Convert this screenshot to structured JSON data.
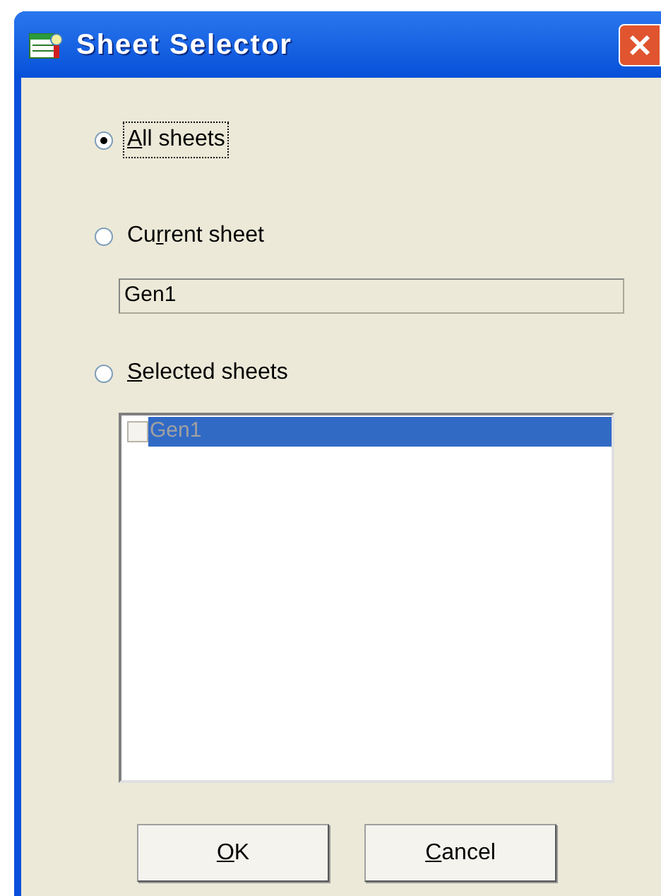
{
  "window": {
    "title": "Sheet Selector"
  },
  "options": [
    {
      "key": "A",
      "post": "ll sheets",
      "selected": true,
      "focused": true
    },
    {
      "pre": "Cu",
      "key": "r",
      "post": "rent sheet",
      "selected": false,
      "focused": false
    },
    {
      "key": "S",
      "post": "elected sheets",
      "selected": false,
      "focused": false
    }
  ],
  "current_sheet_field": {
    "value": "Gen1"
  },
  "sheet_list": [
    {
      "label": "Gen1",
      "checked": false,
      "selected": true
    }
  ],
  "buttons": [
    {
      "key": "O",
      "post": "K"
    },
    {
      "key": "C",
      "post": "ancel"
    }
  ]
}
